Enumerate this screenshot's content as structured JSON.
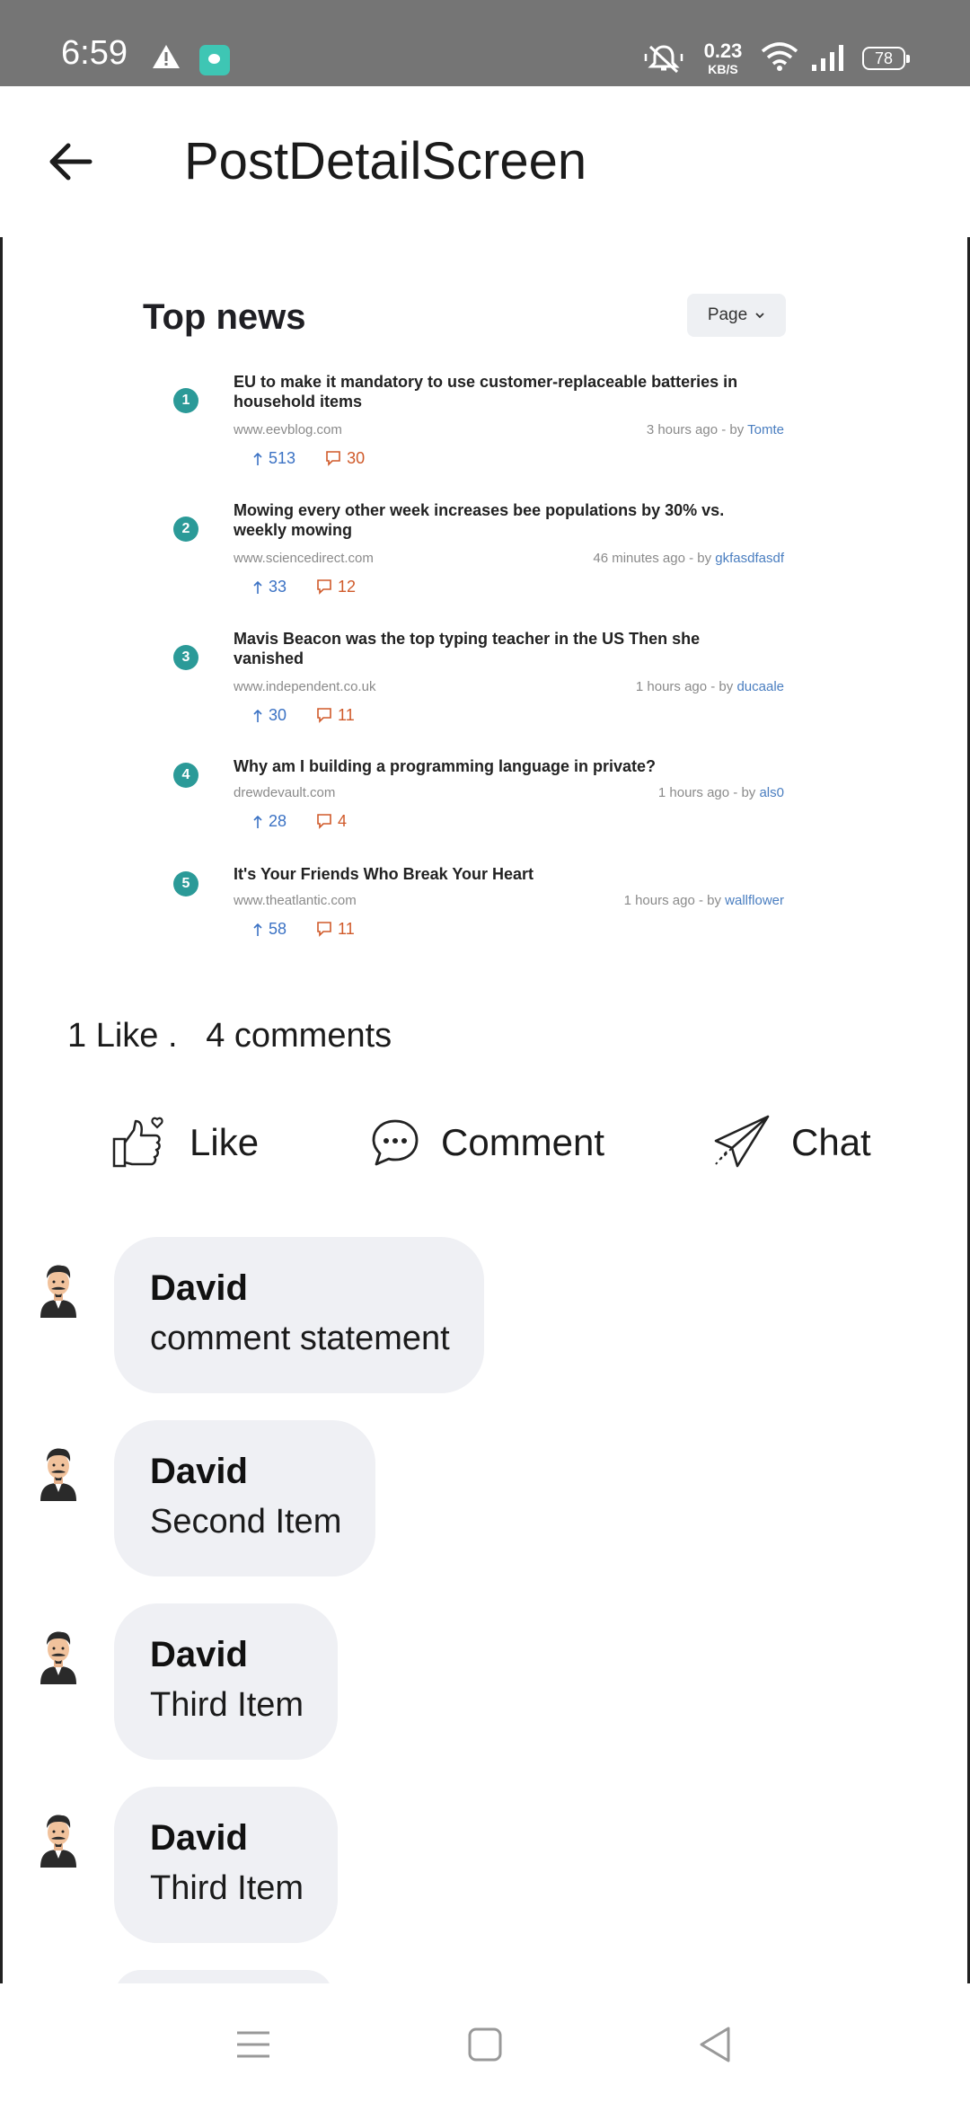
{
  "status_bar": {
    "time": "6:59",
    "net_speed_value": "0.23",
    "net_speed_unit": "KB/S",
    "battery": "78",
    "icons": [
      "alert-icon",
      "app-notification-icon",
      "mute-icon",
      "wifi-icon",
      "signal-icon",
      "battery-icon"
    ]
  },
  "app_bar": {
    "title": "PostDetailScreen",
    "back_icon": "arrow-left-icon"
  },
  "post": {
    "image": {
      "heading": "Top news",
      "page_button": "Page",
      "items": [
        {
          "rank": "1",
          "title_line1": "EU to make it mandatory to use customer-replaceable batteries in",
          "title_line2": "household items",
          "source": "www.eevblog.com",
          "time": "3 hours ago - by",
          "author": "Tomte",
          "upvotes": "513",
          "comments": "30"
        },
        {
          "rank": "2",
          "title_line1": "Mowing every other week increases bee populations by 30% vs.",
          "title_line2": "weekly mowing",
          "source": "www.sciencedirect.com",
          "time": "46 minutes ago - by",
          "author": "gkfasdfasdf",
          "upvotes": "33",
          "comments": "12"
        },
        {
          "rank": "3",
          "title_line1": "Mavis Beacon was the top typing teacher in the US Then she",
          "title_line2": "vanished",
          "source": "www.independent.co.uk",
          "time": "1 hours ago - by",
          "author": "ducaale",
          "upvotes": "30",
          "comments": "11"
        },
        {
          "rank": "4",
          "title_line1": "Why am I building a programming language in private?",
          "title_line2": "",
          "source": "drewdevault.com",
          "time": "1 hours ago - by",
          "author": "als0",
          "upvotes": "28",
          "comments": "4"
        },
        {
          "rank": "5",
          "title_line1": "It's Your Friends Who Break Your Heart",
          "title_line2": "",
          "source": "www.theatlantic.com",
          "time": "1 hours ago - by",
          "author": "wallflower",
          "upvotes": "58",
          "comments": "11"
        }
      ]
    },
    "counts_text": "1 Like .   4 comments",
    "actions": {
      "like": "Like",
      "comment": "Comment",
      "chat": "Chat"
    }
  },
  "comments": [
    {
      "name": "David",
      "text": "comment statement"
    },
    {
      "name": "David",
      "text": "Second Item"
    },
    {
      "name": "David",
      "text": "Third Item"
    },
    {
      "name": "David",
      "text": "Third Item"
    }
  ],
  "nav_bar": {
    "icons": [
      "menu-icon",
      "home-square-icon",
      "back-triangle-icon"
    ]
  }
}
